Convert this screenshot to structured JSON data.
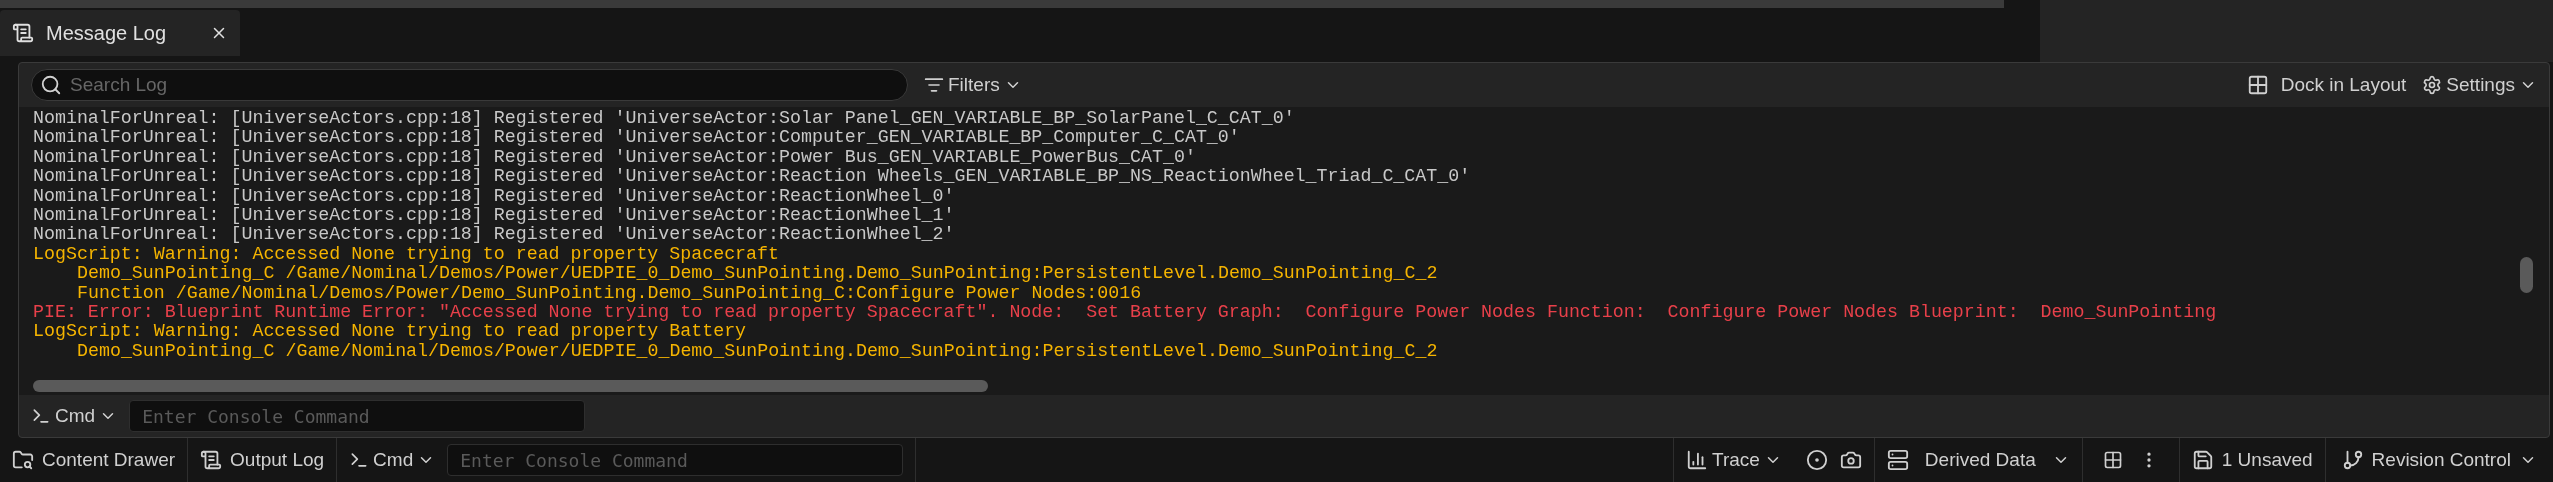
{
  "tab": {
    "title": "Message Log"
  },
  "toolbar": {
    "search": {
      "placeholder": "Search Log"
    },
    "filters": "Filters",
    "dock": "Dock in Layout",
    "settings": "Settings"
  },
  "log": [
    {
      "kind": "info",
      "text": "NominalForUnreal: [UniverseActors.cpp:18] Registered 'UniverseActor:Solar Panel_GEN_VARIABLE_BP_SolarPanel_C_CAT_0'"
    },
    {
      "kind": "info",
      "text": "NominalForUnreal: [UniverseActors.cpp:18] Registered 'UniverseActor:Computer_GEN_VARIABLE_BP_Computer_C_CAT_0'"
    },
    {
      "kind": "info",
      "text": "NominalForUnreal: [UniverseActors.cpp:18] Registered 'UniverseActor:Power Bus_GEN_VARIABLE_PowerBus_CAT_0'"
    },
    {
      "kind": "info",
      "text": "NominalForUnreal: [UniverseActors.cpp:18] Registered 'UniverseActor:Reaction Wheels_GEN_VARIABLE_BP_NS_ReactionWheel_Triad_C_CAT_0'"
    },
    {
      "kind": "info",
      "text": "NominalForUnreal: [UniverseActors.cpp:18] Registered 'UniverseActor:ReactionWheel_0'"
    },
    {
      "kind": "info",
      "text": "NominalForUnreal: [UniverseActors.cpp:18] Registered 'UniverseActor:ReactionWheel_1'"
    },
    {
      "kind": "info",
      "text": "NominalForUnreal: [UniverseActors.cpp:18] Registered 'UniverseActor:ReactionWheel_2'"
    },
    {
      "kind": "warning",
      "text": "LogScript: Warning: Accessed None trying to read property Spacecraft",
      "children": [
        "Demo_SunPointing_C /Game/Nominal/Demos/Power/UEDPIE_0_Demo_SunPointing.Demo_SunPointing:PersistentLevel.Demo_SunPointing_C_2",
        "Function /Game/Nominal/Demos/Power/Demo_SunPointing.Demo_SunPointing_C:Configure Power Nodes:0016"
      ]
    },
    {
      "kind": "error",
      "text": "PIE: Error: Blueprint Runtime Error: \"Accessed None trying to read property Spacecraft\". Node:  Set Battery Graph:  Configure Power Nodes Function:  Configure Power Nodes Blueprint:  Demo_SunPointing"
    },
    {
      "kind": "warning",
      "text": "LogScript: Warning: Accessed None trying to read property Battery",
      "children": [
        "Demo_SunPointing_C /Game/Nominal/Demos/Power/UEDPIE_0_Demo_SunPointing.Demo_SunPointing:PersistentLevel.Demo_SunPointing_C_2"
      ]
    }
  ],
  "console": {
    "mode": "Cmd",
    "placeholder": "Enter Console Command"
  },
  "status_bar": {
    "content_drawer": "Content Drawer",
    "output_log": "Output Log",
    "console": {
      "mode": "Cmd",
      "placeholder": "Enter Console Command"
    },
    "trace": "Trace",
    "derived_data": "Derived Data",
    "unsaved": "1 Unsaved",
    "revision_control": "Revision Control"
  }
}
